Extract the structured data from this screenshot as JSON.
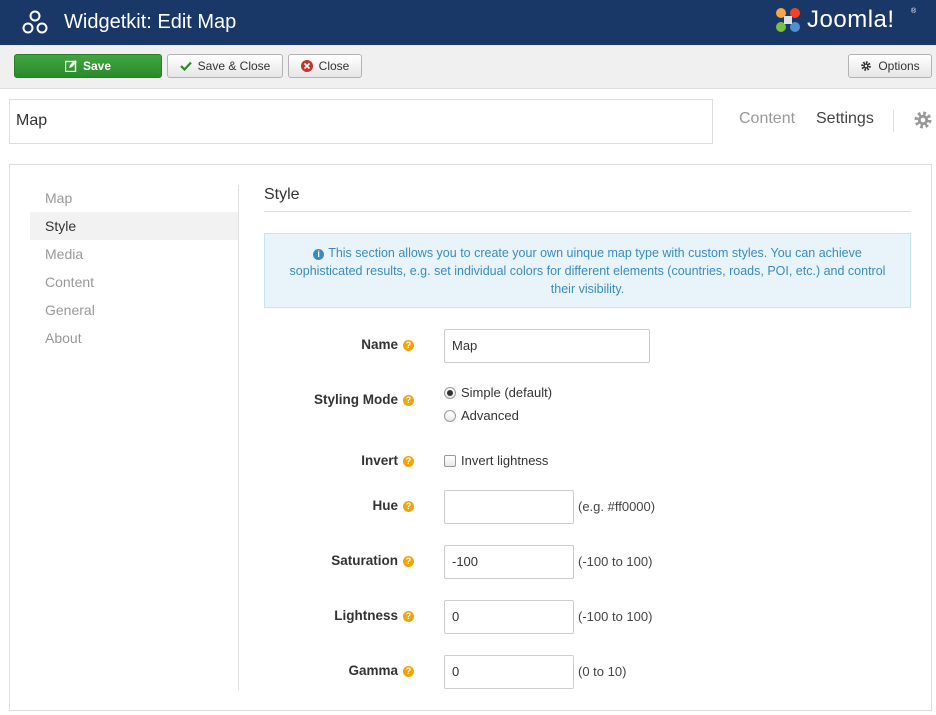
{
  "header": {
    "title": "Widgetkit: Edit Map",
    "app_icon": "widgetkit-icon",
    "logo_text": "Joomla!",
    "logo_reg": "®"
  },
  "toolbar": {
    "save_label": "Save",
    "save_close_label": "Save & Close",
    "close_label": "Close",
    "options_label": "Options"
  },
  "title_input": {
    "value": "Map"
  },
  "tabs": {
    "content": "Content",
    "settings": "Settings"
  },
  "sidebar": {
    "items": [
      {
        "label": "Map"
      },
      {
        "label": "Style"
      },
      {
        "label": "Media"
      },
      {
        "label": "Content"
      },
      {
        "label": "General"
      },
      {
        "label": "About"
      }
    ],
    "active": "Style"
  },
  "section": {
    "title": "Style",
    "info": "This section allows you to create your own uinque map type with custom styles. You can achieve sophisticated results, e.g. set individual colors for different elements (countries, roads, POI, etc.) and control their visibility."
  },
  "form": {
    "name": {
      "label": "Name",
      "value": "Map"
    },
    "styling_mode": {
      "label": "Styling Mode",
      "options": [
        "Simple (default)",
        "Advanced"
      ],
      "selected": "Simple (default)"
    },
    "invert": {
      "label": "Invert",
      "option": "Invert lightness",
      "checked": false
    },
    "hue": {
      "label": "Hue",
      "value": "",
      "hint": "(e.g. #ff0000)"
    },
    "saturation": {
      "label": "Saturation",
      "value": "-100",
      "hint": "(-100 to 100)"
    },
    "lightness": {
      "label": "Lightness",
      "value": "0",
      "hint": "(-100 to 100)"
    },
    "gamma": {
      "label": "Gamma",
      "value": "0",
      "hint": "(0 to 10)"
    }
  },
  "colors": {
    "header_bg": "#1a3867",
    "save_green": "#2b8a2b",
    "info_blue": "#3a8bbf",
    "help_orange": "#f0a30a"
  }
}
